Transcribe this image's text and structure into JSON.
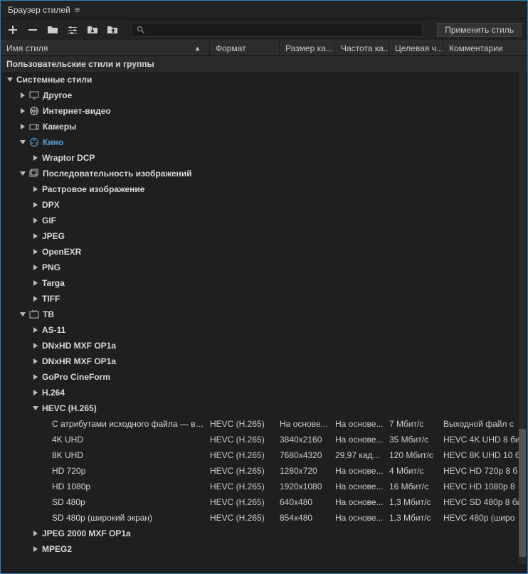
{
  "panel": {
    "title": "Браузер стилей"
  },
  "toolbar": {
    "apply": "Применить стиль",
    "search_placeholder": ""
  },
  "columns": {
    "name": "Имя стиля",
    "format": "Формат",
    "fsize": "Размер ка...",
    "fps": "Частота ка...",
    "rate": "Целевая ч...",
    "comment": "Комментарии"
  },
  "tree": {
    "user_styles": "Пользовательские стили и группы",
    "system_styles": "Системные стили",
    "other": "Другое",
    "internet_video": "Интернет-видео",
    "cameras": "Камеры",
    "cinema": "Кино",
    "wraptor": "Wraptor DCP",
    "image_seq": "Последовательность изображений",
    "raster": "Растровое изображение",
    "dpx": "DPX",
    "gif": "GIF",
    "jpeg": "JPEG",
    "openexr": "OpenEXR",
    "png": "PNG",
    "targa": "Targa",
    "tiff": "TIFF",
    "tv": "ТВ",
    "as11": "AS-11",
    "dnxhd": "DNxHD MXF OP1a",
    "dnxhr": "DNxHR MXF OP1a",
    "gopro": "GoPro CineForm",
    "h264": "H.264",
    "hevc": "HEVC (H.265)",
    "jpeg2000": "JPEG 2000 MXF OP1a",
    "mpeg2": "MPEG2"
  },
  "presets": [
    {
      "name": "С атрибутами исходного файла — высо...",
      "format": "HEVC (H.265)",
      "fsize": "На основе...",
      "fps": "На основе...",
      "rate": "7 Мбит/с",
      "comment": "Выходной файл с"
    },
    {
      "name": "4K UHD",
      "format": "HEVC (H.265)",
      "fsize": "3840x2160",
      "fps": "На основе...",
      "rate": "35 Мбит/с",
      "comment": "HEVC 4K UHD 8 би"
    },
    {
      "name": "8K UHD",
      "format": "HEVC (H.265)",
      "fsize": "7680x4320",
      "fps": "29,97 кад...",
      "rate": "120 Мбит/с",
      "comment": "HEVC 8K UHD 10 б"
    },
    {
      "name": "HD 720p",
      "format": "HEVC (H.265)",
      "fsize": "1280x720",
      "fps": "На основе...",
      "rate": "4 Мбит/с",
      "comment": "HEVC HD 720p 8 б"
    },
    {
      "name": "HD 1080p",
      "format": "HEVC (H.265)",
      "fsize": "1920x1080",
      "fps": "На основе...",
      "rate": "16 Мбит/с",
      "comment": "HEVC HD 1080p 8"
    },
    {
      "name": "SD 480p",
      "format": "HEVC (H.265)",
      "fsize": "640x480",
      "fps": "На основе...",
      "rate": "1,3 Мбит/с",
      "comment": "HEVC SD 480p 8 би"
    },
    {
      "name": "SD 480p (широкий экран)",
      "format": "HEVC (H.265)",
      "fsize": "854x480",
      "fps": "На основе...",
      "rate": "1,3 Мбит/с",
      "comment": "HEVC 480p (широ"
    }
  ]
}
